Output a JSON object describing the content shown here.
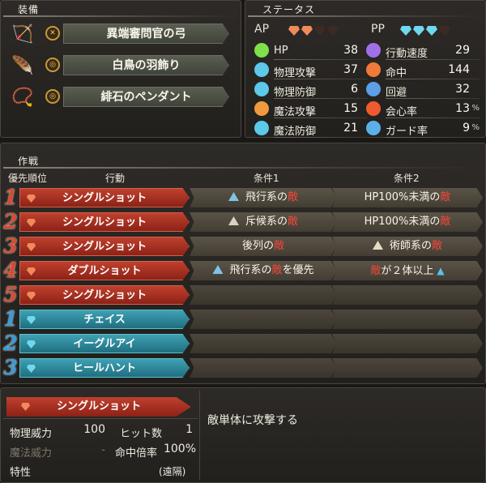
{
  "equipment": {
    "title": "装備",
    "items": [
      {
        "name": "異端審問官の弓",
        "icon": "bow-icon",
        "slot_icon": "bow-slot-icon"
      },
      {
        "name": "白鳥の羽飾り",
        "icon": "feather-icon",
        "slot_icon": "accessory-slot-icon"
      },
      {
        "name": "緋石のペンダント",
        "icon": "pendant-icon",
        "slot_icon": "accessory-slot-icon"
      }
    ]
  },
  "status": {
    "title": "ステータス",
    "ap_label": "AP",
    "pp_label": "PP",
    "ap_filled": 2,
    "ap_total": 4,
    "pp_filled": 3,
    "pp_total": 4,
    "ap_color": "#f08a5a",
    "pp_color": "#6ed8ee",
    "left": [
      {
        "label": "HP",
        "value": "38",
        "icon": "heart-icon",
        "color": "#7ee04a"
      },
      {
        "label": "物理攻撃",
        "value": "37",
        "icon": "sword-icon",
        "color": "#5cc8ea"
      },
      {
        "label": "物理防御",
        "value": "6",
        "icon": "armor-icon",
        "color": "#5cc8ea"
      },
      {
        "label": "魔法攻撃",
        "value": "15",
        "icon": "staff-icon",
        "color": "#f09a40"
      },
      {
        "label": "魔法防御",
        "value": "21",
        "icon": "robe-icon",
        "color": "#5cc8ea"
      }
    ],
    "right": [
      {
        "label": "行動速度",
        "value": "29",
        "pct": "",
        "icon": "speed-icon",
        "color": "#a070e8"
      },
      {
        "label": "命中",
        "value": "144",
        "pct": "",
        "icon": "target-icon",
        "color": "#f07a3a"
      },
      {
        "label": "回避",
        "value": "32",
        "pct": "",
        "icon": "evade-icon",
        "color": "#5c9eea"
      },
      {
        "label": "会心率",
        "value": "13",
        "pct": "%",
        "icon": "crit-icon",
        "color": "#f05a30"
      },
      {
        "label": "ガード率",
        "value": "9",
        "pct": "%",
        "icon": "shield-icon",
        "color": "#5cb0ea"
      }
    ]
  },
  "tactics": {
    "title": "作戦",
    "headers": {
      "priority": "優先順位",
      "action": "行動",
      "cond1": "条件1",
      "cond2": "条件2"
    },
    "rows": [
      {
        "num": "1",
        "type": "active",
        "action": "シングルショット",
        "cond1": {
          "pre": "飛行系の",
          "red": "敵",
          "post": "",
          "icon": "flying-icon"
        },
        "cond2": {
          "pre": "HP100%未満の",
          "red": "敵",
          "post": "",
          "icon": ""
        }
      },
      {
        "num": "2",
        "type": "active",
        "action": "シングルショット",
        "cond1": {
          "pre": "斥候系の",
          "red": "敵",
          "post": "",
          "icon": "scout-icon"
        },
        "cond2": {
          "pre": "HP100%未満の",
          "red": "敵",
          "post": "",
          "icon": ""
        }
      },
      {
        "num": "3",
        "type": "active",
        "action": "シングルショット",
        "cond1": {
          "pre": "後列の",
          "red": "敵",
          "post": "",
          "icon": ""
        },
        "cond2": {
          "pre": "術師系の",
          "red": "敵",
          "post": "",
          "icon": "mage-icon"
        }
      },
      {
        "num": "4",
        "type": "active",
        "action": "ダブルショット",
        "cond1": {
          "pre": "飛行系の",
          "red": "敵",
          "post": "を優先",
          "icon": "flying-icon"
        },
        "cond2": {
          "pre": "",
          "red": "敵",
          "post": "が２体以上",
          "icon": "",
          "up": "▲"
        }
      },
      {
        "num": "5",
        "type": "active",
        "action": "シングルショット",
        "cond1": null,
        "cond2": null
      },
      {
        "num": "1",
        "type": "passive",
        "action": "チェイス",
        "cond1": null,
        "cond2": null
      },
      {
        "num": "2",
        "type": "passive",
        "action": "イーグルアイ",
        "cond1": null,
        "cond2": null
      },
      {
        "num": "3",
        "type": "passive",
        "action": "ヒールハント",
        "cond1": null,
        "cond2": null
      }
    ]
  },
  "skill_detail": {
    "name": "シングルショット",
    "phys_power_label": "物理威力",
    "phys_power": "100",
    "hits_label": "ヒット数",
    "hits": "1",
    "mag_power_label": "魔法威力",
    "mag_power": "-",
    "accuracy_label": "命中倍率",
    "accuracy": "100%",
    "trait_label": "特性",
    "trait": "(遠隔)",
    "description": "敵単体に攻撃する"
  },
  "colors": {
    "active": "#b03a28",
    "passive": "#2f8fa0",
    "num_active": "#d94a30",
    "num_passive": "#3a9ad8"
  }
}
